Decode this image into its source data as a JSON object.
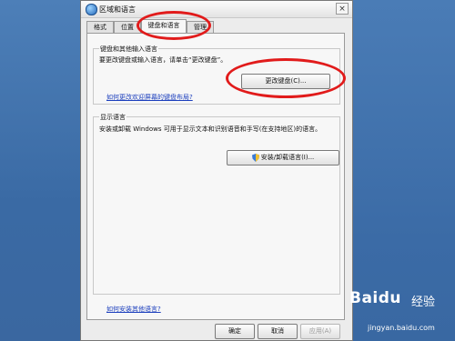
{
  "window": {
    "title": "区域和语言",
    "close_glyph": "×"
  },
  "tabs": [
    {
      "label": "格式"
    },
    {
      "label": "位置"
    },
    {
      "label": "键盘和语言",
      "active": true
    },
    {
      "label": "管理"
    }
  ],
  "keyboard_group": {
    "title": "键盘和其他输入语言",
    "description": "要更改键盘或输入语言，请单击“更改键盘”。",
    "change_button": "更改键盘(C)...",
    "link": "如何更改欢迎屏幕的键盘布局?"
  },
  "display_group": {
    "title": "显示语言",
    "description": "安装或卸载 Windows 可用于显示文本和识别语音和手写(在支持地区)的语言。",
    "install_button": "安装/卸载语言(I)..."
  },
  "bottom_link": "如何安装其他语言?",
  "footer": {
    "ok": "确定",
    "cancel": "取消",
    "apply": "应用(A)"
  },
  "watermark": {
    "logo": "Baidu",
    "product": "经验",
    "url": "jingyan.baidu.com"
  },
  "colors": {
    "desktop": "#3d6fa9",
    "callout": "#e11b1b",
    "link": "#1c3fbd"
  }
}
